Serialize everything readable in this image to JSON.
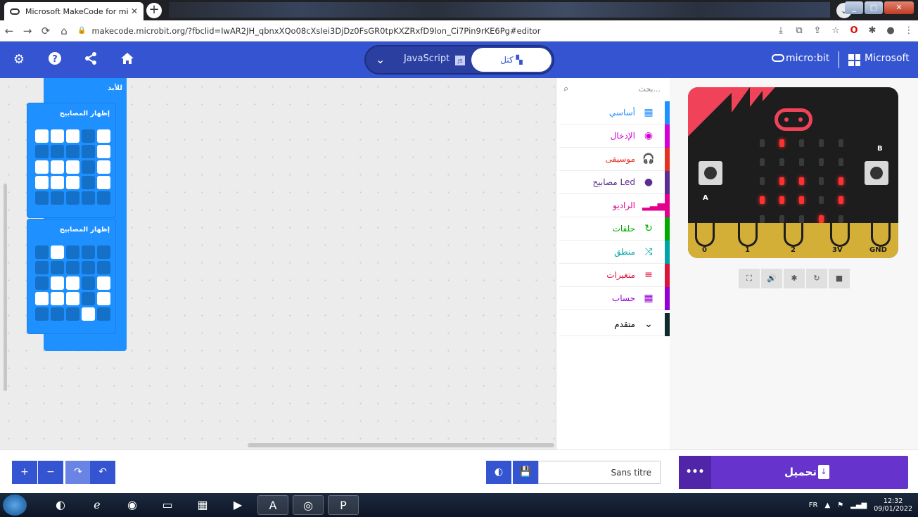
{
  "browser": {
    "tab_title": "Microsoft MakeCode for micro:bit",
    "tab_close": "✕",
    "new_tab": "+",
    "url": "makecode.microbit.org/?fbclid=IwAR2JH_qbnxXQo08cXsIei3DjDz0FsGR0tpKXZRxfD9lon_Ci7Pin9rKE6Pg#editor",
    "nav": {
      "back": "←",
      "forward": "→",
      "reload": "⟳",
      "home": "⌂"
    },
    "extensions": [
      "⤓",
      "⧉",
      "⇪",
      "☆",
      "O",
      "✱",
      "●",
      "⋮"
    ]
  },
  "header": {
    "icons": [
      "gear-icon",
      "help-icon",
      "share-icon",
      "home-icon"
    ],
    "toggle": {
      "chevron": "⌄",
      "javascript_label": "JavaScript",
      "js_badge": "JS",
      "blocks_label": "كتل"
    },
    "brand": "micro:bit",
    "microsoft": "Microsoft"
  },
  "workspace": {
    "forever_label": "للأبد",
    "show_leds_label": "إظهار المصابيح",
    "block1_leds": [
      [
        1,
        1,
        1,
        0,
        1
      ],
      [
        0,
        0,
        0,
        0,
        1
      ],
      [
        1,
        1,
        1,
        0,
        1
      ],
      [
        1,
        1,
        1,
        0,
        1
      ],
      [
        0,
        0,
        0,
        0,
        0
      ]
    ],
    "block2_leds": [
      [
        0,
        1,
        0,
        0,
        0
      ],
      [
        0,
        0,
        0,
        0,
        0
      ],
      [
        0,
        1,
        1,
        0,
        1
      ],
      [
        1,
        1,
        1,
        0,
        1
      ],
      [
        0,
        0,
        0,
        1,
        0
      ]
    ]
  },
  "toolbox": {
    "search_placeholder": "بحث...",
    "categories": [
      {
        "label": "أساسي",
        "color": "#1e90ff",
        "icon": "▦"
      },
      {
        "label": "الإدخال",
        "color": "#d400d4",
        "icon": "◉"
      },
      {
        "label": "موسيقى",
        "color": "#e63022",
        "icon": "🎧"
      },
      {
        "label": "مصابيح Led",
        "color": "#5c2d91",
        "icon": "●"
      },
      {
        "label": "الراديو",
        "color": "#e3008c",
        "icon": "▂▃▅▇"
      },
      {
        "label": "حلقات",
        "color": "#00aa00",
        "icon": "↻"
      },
      {
        "label": "منطق",
        "color": "#00a4a6",
        "icon": "⤨"
      },
      {
        "label": "متغيرات",
        "color": "#dc143c",
        "icon": "≡"
      },
      {
        "label": "حساب",
        "color": "#9400d3",
        "icon": "▦"
      },
      {
        "label": "متقدم",
        "color": "#0f2a2a",
        "icon": "⌄"
      }
    ],
    "collapse": "›"
  },
  "simulator": {
    "button_a": "A",
    "button_b": "B",
    "pins": [
      "0",
      "1",
      "2",
      "3V",
      "GND"
    ],
    "leds": [
      [
        0,
        1,
        0,
        0,
        0
      ],
      [
        0,
        0,
        0,
        0,
        0
      ],
      [
        0,
        1,
        1,
        0,
        1
      ],
      [
        1,
        1,
        1,
        0,
        1
      ],
      [
        0,
        0,
        0,
        1,
        0
      ]
    ],
    "controls": [
      "⛶",
      "🔊",
      "✱",
      "↻",
      "■"
    ]
  },
  "bottom": {
    "zoom_in": "+",
    "zoom_out": "−",
    "redo": "↷",
    "undo": "↶",
    "github": "◐",
    "save": "💾",
    "project_name": "Sans titre",
    "download_label": "تحميل",
    "more": "•••"
  },
  "taskbar": {
    "lang": "FR",
    "time": "12:32",
    "date": "09/01/2022"
  }
}
